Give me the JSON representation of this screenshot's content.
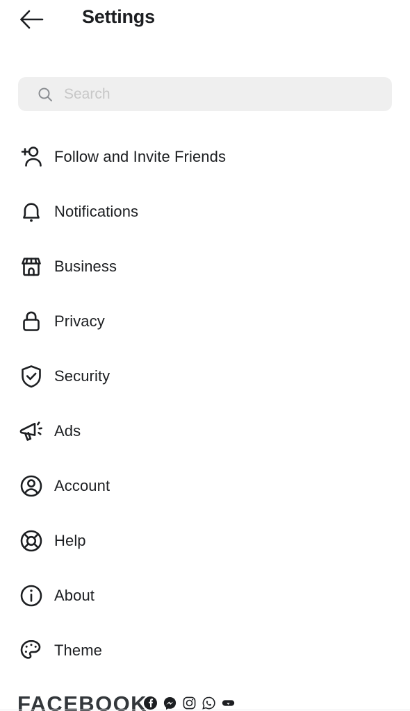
{
  "header": {
    "title": "Settings",
    "back_icon": "arrow-left-icon"
  },
  "search": {
    "placeholder": "Search",
    "value": "",
    "icon": "search-icon",
    "background": "#efefef"
  },
  "menu": {
    "items": [
      {
        "label": "Follow and Invite Friends",
        "icon": "person-add-icon"
      },
      {
        "label": "Notifications",
        "icon": "bell-icon"
      },
      {
        "label": "Business",
        "icon": "storefront-icon"
      },
      {
        "label": "Privacy",
        "icon": "lock-icon"
      },
      {
        "label": "Security",
        "icon": "shield-check-icon"
      },
      {
        "label": "Ads",
        "icon": "megaphone-icon"
      },
      {
        "label": "Account",
        "icon": "user-circle-icon"
      },
      {
        "label": "Help",
        "icon": "lifebuoy-icon"
      },
      {
        "label": "About",
        "icon": "info-circle-icon"
      },
      {
        "label": "Theme",
        "icon": "palette-icon"
      }
    ]
  },
  "footer": {
    "wordmark": "FACEBOOK",
    "apps": [
      {
        "name": "facebook-app-icon"
      },
      {
        "name": "messenger-app-icon"
      },
      {
        "name": "instagram-app-icon"
      },
      {
        "name": "whatsapp-app-icon"
      },
      {
        "name": "oculus-app-icon"
      }
    ]
  },
  "colors": {
    "text_primary": "#1c1e21",
    "text_placeholder": "#c7c7c7",
    "search_background": "#efefef",
    "icon_stroke": "#1c1e21"
  }
}
